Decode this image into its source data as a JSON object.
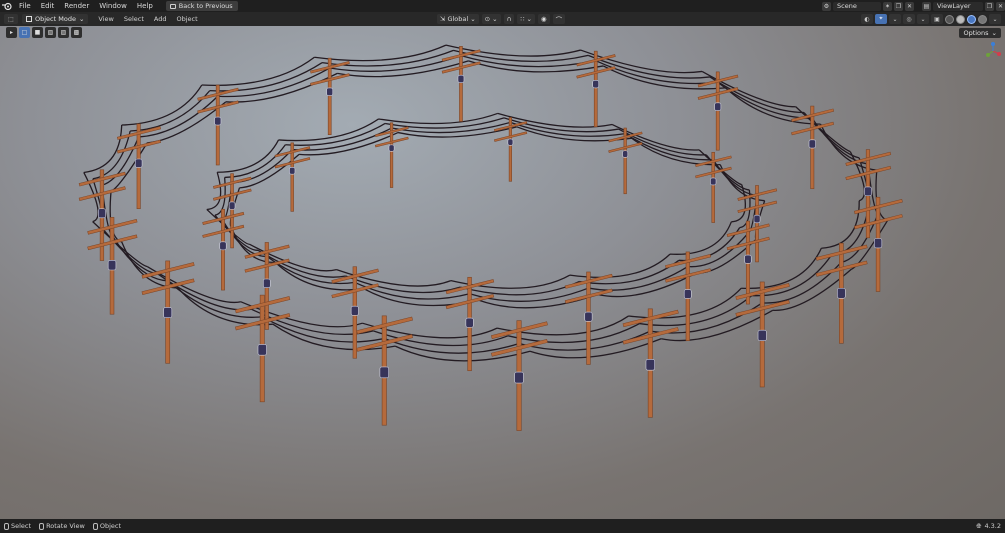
{
  "topbar": {
    "menus": [
      "File",
      "Edit",
      "Render",
      "Window",
      "Help"
    ],
    "back_button": "Back to Previous",
    "scene_name": "Scene",
    "view_layer": "ViewLayer"
  },
  "header": {
    "mode": "Object Mode",
    "menus": [
      "View",
      "Select",
      "Add",
      "Object"
    ],
    "transform_orientation": "Global"
  },
  "viewport": {
    "options_label": "Options"
  },
  "statusbar": {
    "items": [
      "Select",
      "Rotate View",
      "Object"
    ],
    "version": "4.3.2"
  },
  "colors": {
    "pole_wood": "#b56a3c",
    "pole_dark": "#7a4426",
    "insulator": "#37345a",
    "wire": "#231b22",
    "accent": "#4772b3"
  }
}
